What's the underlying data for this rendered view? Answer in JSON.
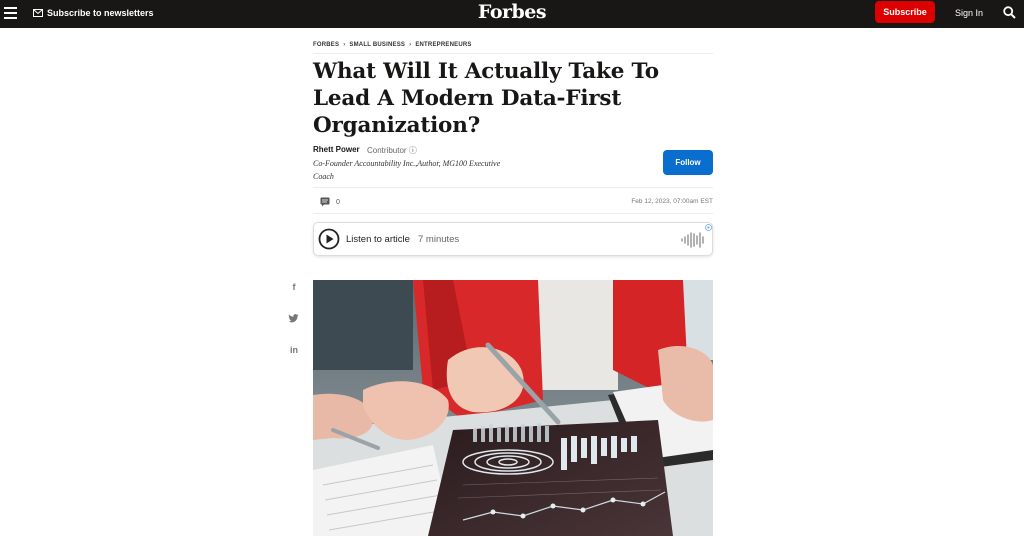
{
  "header": {
    "newsletter_label": "Subscribe to newsletters",
    "logo_text": "Forbes",
    "subscribe_label": "Subscribe",
    "signin_label": "Sign In"
  },
  "breadcrumb": [
    "FORBES",
    "SMALL BUSINESS",
    "ENTREPRENEURS"
  ],
  "article": {
    "title": "What Will It Actually Take To Lead A Modern Data-First Organization?",
    "author_name": "Rhett Power",
    "author_role": "Contributor",
    "author_desc": "Co-Founder Accountability Inc.,Author, MG100 Executive Coach",
    "follow_label": "Follow",
    "comment_count": "0",
    "date": "Feb 12, 2023, 07:00am EST"
  },
  "audio": {
    "label": "Listen to article",
    "duration": "7 minutes"
  },
  "share": {
    "facebook": "f",
    "twitter": "",
    "linkedin": "in"
  },
  "colors": {
    "topbar": "#181716",
    "subscribe": "#dc0000",
    "follow": "#0a6ecf"
  }
}
